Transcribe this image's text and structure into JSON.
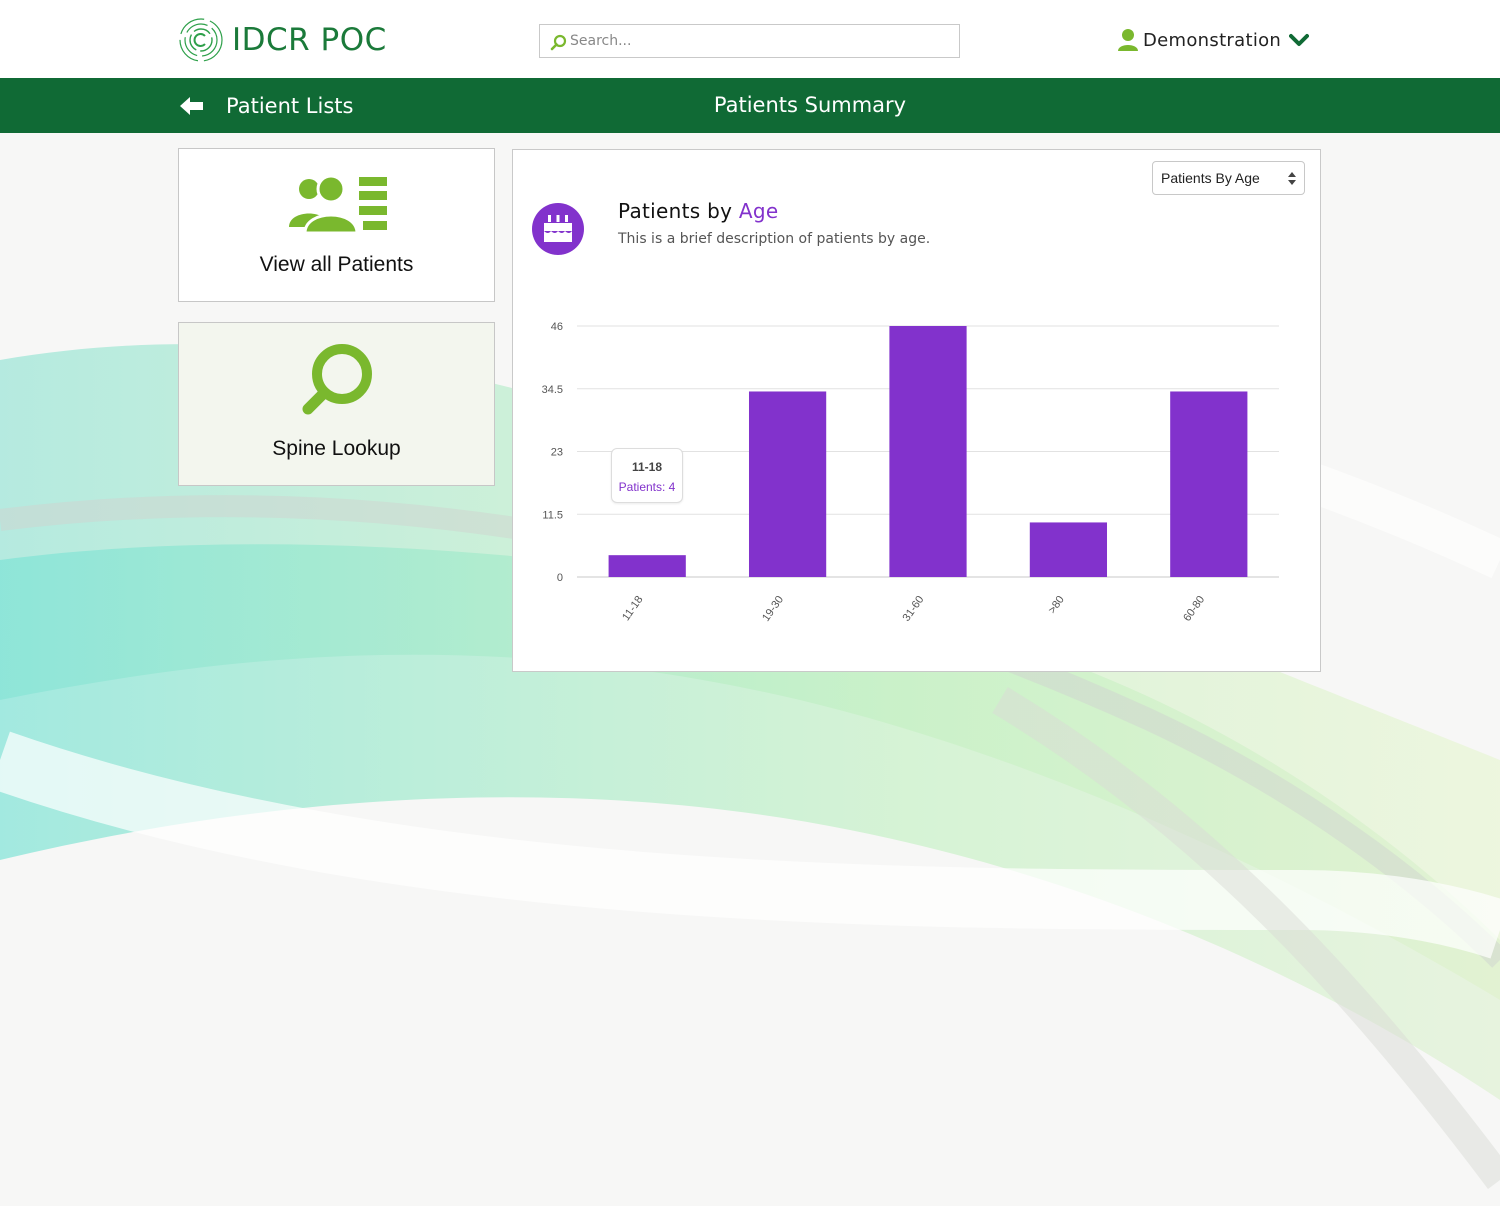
{
  "app": {
    "name": "IDCR POC",
    "search_placeholder": "Search...",
    "user_name": "Demonstration"
  },
  "nav": {
    "back_label": "Patient Lists",
    "page_title": "Patients Summary"
  },
  "tiles": [
    {
      "label": "View all Patients",
      "icon": "patients-list-icon"
    },
    {
      "label": "Spine Lookup",
      "icon": "magnifier-icon"
    }
  ],
  "chart_panel": {
    "selected_view": "Patients By Age",
    "heading_prefix": "Patients by",
    "heading_accent": "Age",
    "description": "This is a brief description of patients by age.",
    "tooltip": {
      "title": "11-18",
      "value": "Patients: 4"
    }
  },
  "colors": {
    "brand_green": "#106a35",
    "icon_green": "#7ab82e",
    "accent_purple": "#8232cc"
  },
  "chart_data": {
    "type": "bar",
    "categories": [
      "11-18",
      "19-30",
      "31-60",
      ">80",
      "60-80"
    ],
    "values": [
      4,
      34,
      46,
      10,
      34
    ],
    "yticks": [
      "0",
      "11.5",
      "23",
      "34.5",
      "46"
    ],
    "ylim": [
      0,
      46
    ],
    "grid": true,
    "bar_color": "#8232cc",
    "xlabel": "",
    "ylabel": ""
  }
}
